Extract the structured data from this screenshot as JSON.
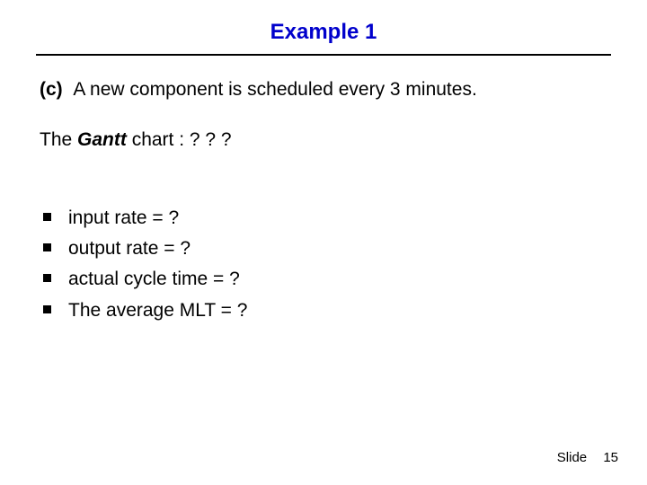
{
  "title": "Example 1",
  "para_c": {
    "label": "(c)",
    "text": "A new component is scheduled every 3 minutes."
  },
  "gantt": {
    "prefix": "The ",
    "emph": "Gantt",
    "suffix": " chart :   ? ? ?"
  },
  "bullets": [
    "input rate = ?",
    "output rate = ?",
    "actual cycle time = ?",
    "The average MLT = ?"
  ],
  "footer": {
    "label": "Slide",
    "number": "15"
  }
}
